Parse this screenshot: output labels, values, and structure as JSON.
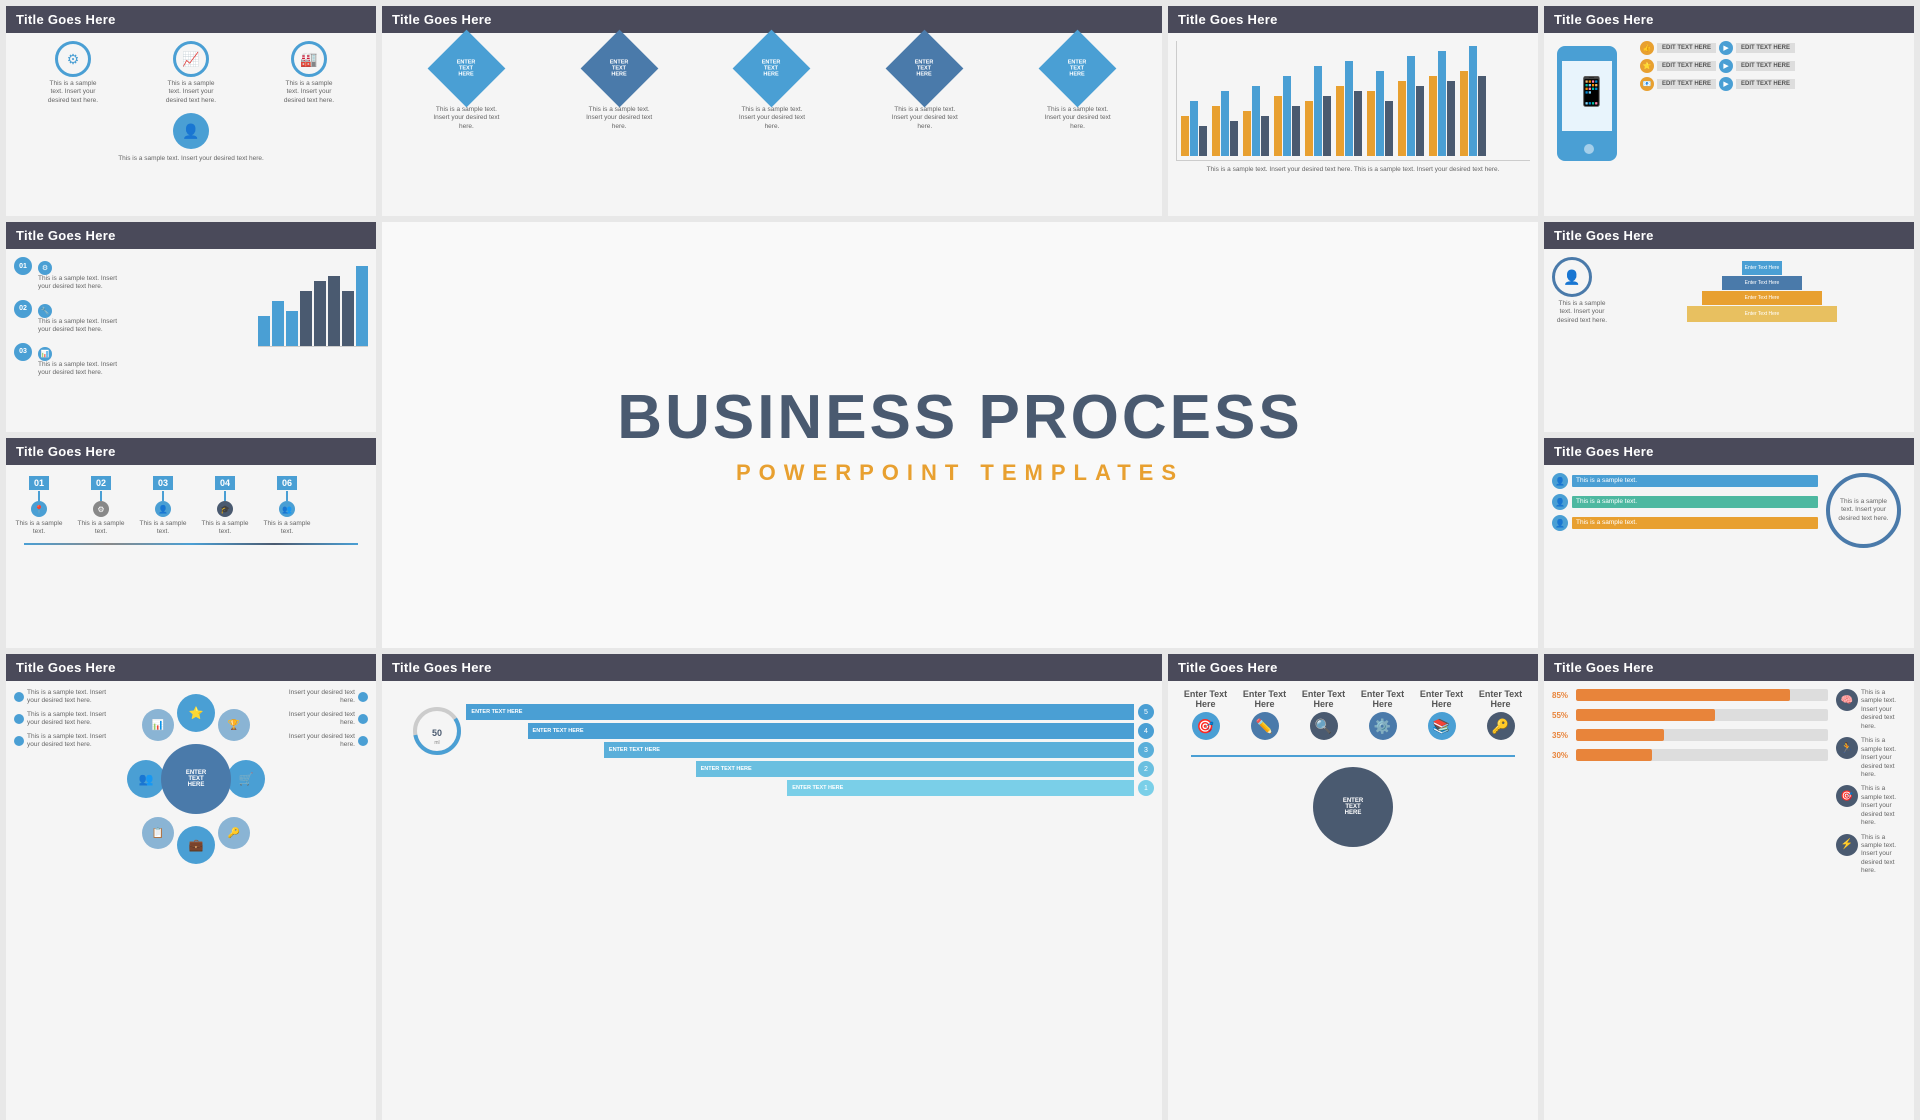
{
  "slides": [
    {
      "id": "slide1",
      "title": "Title Goes Here",
      "type": "icons-with-text",
      "sample_text": "This is a sample text. Insert your desired text here."
    },
    {
      "id": "slide2",
      "title": "Title Goes Here",
      "type": "diamonds",
      "diamond_labels": [
        "ENTER TEXT HERE",
        "ENTER TEXT HERE",
        "ENTER TEXT HERE",
        "ENTER TEXT HERE",
        "ENTER TEXT HERE"
      ]
    },
    {
      "id": "slide3",
      "title": "Title Goes Here",
      "type": "bar-chart-multi"
    },
    {
      "id": "slide4",
      "title": "Title Goes Here",
      "type": "mobile-icons",
      "edit_labels": [
        "EDIT TEXT HERE",
        "EDIT TEXT HERE",
        "EDIT TEXT HERE",
        "EDIT TEXT HERE",
        "EDIT TEXT HERE",
        "EDIT TEXT HERE"
      ]
    },
    {
      "id": "slide5",
      "title": "Title Goes Here",
      "type": "timeline-bars"
    },
    {
      "id": "slide6",
      "title": "Title Goes Here",
      "type": "pyramid",
      "pyramid_labels": [
        "Enter Text Here",
        "Enter Text Here",
        "Enter Text Here",
        "Enter Text Here"
      ]
    },
    {
      "id": "slide7",
      "title": "Title Goes Here",
      "type": "numbered-timeline"
    },
    {
      "id": "slide8",
      "title": "Title Goes Here",
      "type": "person-bars",
      "items": [
        "This is a sample text. Insert your desired text here.",
        "This is a sample text. Insert your desired text here.",
        "This is a sample text. Insert your desired text here."
      ]
    },
    {
      "id": "slide9",
      "title": "Title Goes Here",
      "type": "hex-cluster"
    },
    {
      "id": "slide10",
      "title": "Title Goes Here",
      "type": "spiral-steps",
      "steps": [
        "ENTER TEXT HERE",
        "ENTER TEXT HERE",
        "ENTER TEXT HERE",
        "ENTER TEXT HERE",
        "ENTER TEXT HERE"
      ]
    },
    {
      "id": "slide11",
      "title": "Title Goes Here",
      "type": "icon-row"
    },
    {
      "id": "slide12",
      "title": "Title Goes Here",
      "type": "progress-bars",
      "bars": [
        {
          "label": "85%",
          "value": 85,
          "color": "#e8843a"
        },
        {
          "label": "55%",
          "value": 55,
          "color": "#e8843a"
        },
        {
          "label": "35%",
          "value": 35,
          "color": "#e8843a"
        },
        {
          "label": "30%",
          "value": 30,
          "color": "#e8843a"
        }
      ]
    }
  ],
  "featured": {
    "title": "BUSINESS PROCESS",
    "subtitle": "POWERPOINT TEMPLATES"
  },
  "colors": {
    "blue": "#4a9fd4",
    "dark_blue": "#4a5a70",
    "orange": "#e8a030",
    "dark_gray": "#4a4a5a",
    "light_gray": "#f5f5f5",
    "teal": "#4db8a0",
    "bar_colors": [
      "#e8a030",
      "#4a9fd4",
      "#4a5a70",
      "#a0c4d8"
    ]
  }
}
